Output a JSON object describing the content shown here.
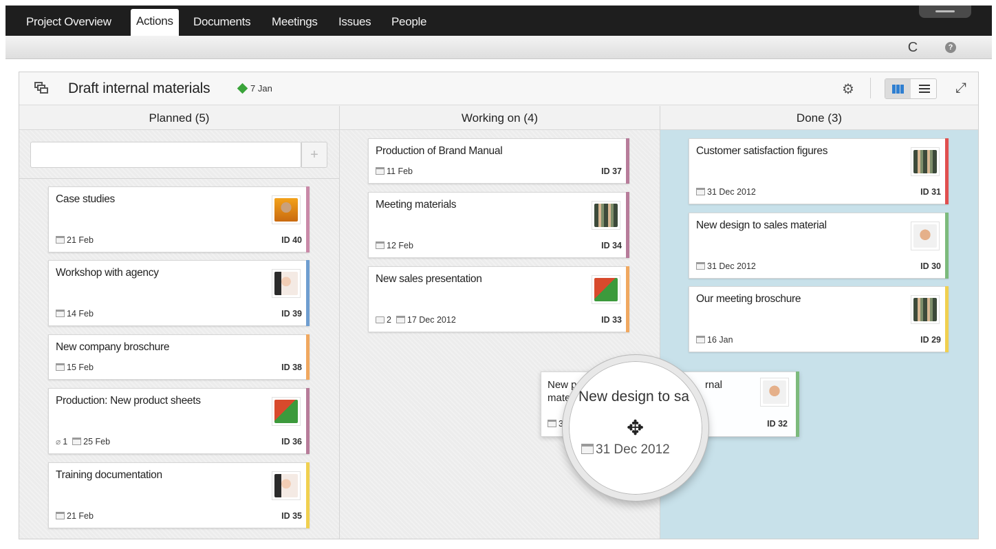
{
  "nav": {
    "tabs": [
      {
        "label": "Project Overview"
      },
      {
        "label": "Actions"
      },
      {
        "label": "Documents"
      },
      {
        "label": "Meetings"
      },
      {
        "label": "Issues"
      },
      {
        "label": "People"
      }
    ],
    "active_tab": "Actions"
  },
  "toolbar": {
    "refresh_icon": "refresh-icon",
    "help_icon": "help-icon",
    "refresh_glyph": "C",
    "help_glyph": "?"
  },
  "board": {
    "title": "Draft internal materials",
    "due_date": "7 Jan",
    "due_color": "#3aa43a",
    "view_selected": "board",
    "columns": [
      {
        "name": "Planned (5)"
      },
      {
        "name": "Working on (4)"
      },
      {
        "name": "Done (3)"
      }
    ],
    "quick_add": {
      "placeholder": "",
      "button": "+"
    }
  },
  "cards": {
    "planned": [
      {
        "title": "Case studies",
        "date": "21 Feb",
        "id": "ID 40",
        "color": "#c98aa8",
        "avatar": "person-photo"
      },
      {
        "title": "Workshop with agency",
        "date": "14 Feb",
        "id": "ID 39",
        "color": "#6f9ed0",
        "avatar": "person-photo"
      },
      {
        "title": "New company broschure",
        "date": "15 Feb",
        "id": "ID 38",
        "color": "#f0a860",
        "avatar": ""
      },
      {
        "title": "Production: New product sheets",
        "attachments": "1",
        "date": "25 Feb",
        "id": "ID 36",
        "color": "#b77c9a",
        "avatar": "person-photo"
      },
      {
        "title": "Training documentation",
        "date": "21 Feb",
        "id": "ID 35",
        "color": "#f0d050",
        "avatar": "person-photo"
      }
    ],
    "working": [
      {
        "title": "Production of Brand Manual",
        "date": "11 Feb",
        "id": "ID 37",
        "color": "#b77c9a"
      },
      {
        "title": "Meeting materials",
        "date": "12 Feb",
        "id": "ID 34",
        "color": "#b77c9a"
      },
      {
        "title": "New sales presentation",
        "comments": "2",
        "date": "17 Dec 2012",
        "id": "ID 33",
        "color": "#f0a860"
      }
    ],
    "done": [
      {
        "title": "Customer satisfaction figures",
        "date": "31 Dec 2012",
        "id": "ID 31",
        "color": "#e05050"
      },
      {
        "title": "New design to sales material",
        "date": "31 Dec 2012",
        "id": "ID 30",
        "color": "#7cba7c"
      },
      {
        "title": "Our meeting broschure",
        "date": "16 Jan",
        "id": "ID 29",
        "color": "#f0d050"
      }
    ]
  },
  "drag": {
    "partial_line1": "New p",
    "partial_line2": "mate",
    "partial_date": "3",
    "partial_right": "rnal",
    "id": "ID 32",
    "color": "#7cba7c",
    "lens_title": "New design to sa",
    "lens_date": "31 Dec 2012",
    "move_glyph": "✥"
  }
}
